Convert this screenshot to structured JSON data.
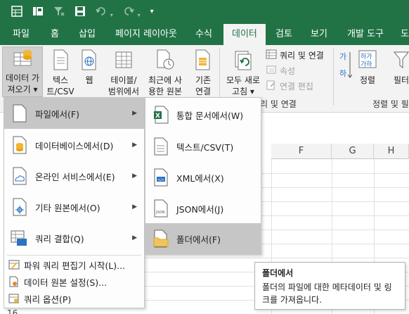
{
  "qat": {
    "icons": [
      "table-icon",
      "save-as-icon",
      "filter-clear-icon",
      "save-icon",
      "undo-icon",
      "redo-icon",
      "customize-icon"
    ]
  },
  "tabs": [
    "파일",
    "홈",
    "삽입",
    "페이지 레이아웃",
    "수식",
    "데이터",
    "검토",
    "보기",
    "개발 도구",
    "도"
  ],
  "active_tab": "데이터",
  "ribbon": {
    "get_data": "데이터 가\n져오기 ▾",
    "text_csv": "텍스\n트/CSV",
    "web": "웹",
    "table_range": "테이블/\n범위에서",
    "recent_sources": "최근에 사\n용한 원본",
    "existing": "기존\n연결",
    "refresh_all": "모두 새로\n고침 ▾",
    "queries_connections": "쿼리 및 연결",
    "properties": "속성",
    "edit_links": "연결 편집",
    "group_queries": "리 및 연결",
    "sort": "정렬",
    "filter": "필터",
    "group_sort": "정렬 및 필"
  },
  "grid": {
    "columns": [
      "F",
      "G",
      "H"
    ],
    "row_last": "16"
  },
  "menu_main": [
    {
      "label": "파일에서(F)",
      "icon": "file-icon",
      "arrow": true,
      "highlighted": true
    },
    {
      "label": "데이터베이스에서(D)",
      "icon": "database-icon",
      "arrow": true
    },
    {
      "label": "온라인 서비스에서(E)",
      "icon": "cloud-icon",
      "arrow": true
    },
    {
      "label": "기타 원본에서(O)",
      "icon": "other-source-icon",
      "arrow": true
    },
    {
      "label": "쿼리 결합(Q)",
      "icon": "combine-query-icon",
      "arrow": true
    },
    {
      "label": "파워 쿼리 편집기 시작(L)...",
      "icon": "power-query-icon",
      "arrow": false
    },
    {
      "label": "데이터 원본 설정(S)...",
      "icon": "source-settings-icon",
      "arrow": false
    },
    {
      "label": "쿼리 옵션(P)",
      "icon": "query-options-icon",
      "arrow": false
    }
  ],
  "menu_sub": [
    {
      "label": "통합 문서에서(W)",
      "icon": "excel-file-icon"
    },
    {
      "label": "텍스트/CSV(T)",
      "icon": "text-file-icon"
    },
    {
      "label": "XML에서(X)",
      "icon": "xml-file-icon"
    },
    {
      "label": "JSON에서(J)",
      "icon": "json-file-icon"
    },
    {
      "label": "폴더에서(F)",
      "icon": "folder-icon",
      "highlighted": true
    }
  ],
  "tooltip": {
    "title": "폴더에서",
    "body": "폴더의 파일에 대한 메타데이터 및 링크를 가져옵니다."
  },
  "colors": {
    "brand": "#217346",
    "ribbon_bg": "#f3f3f3",
    "highlight": "#c6c6c6"
  }
}
